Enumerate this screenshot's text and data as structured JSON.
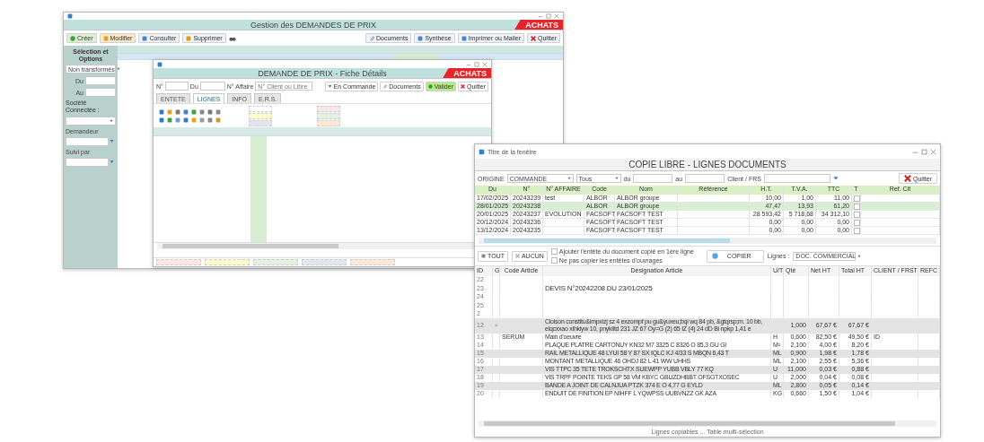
{
  "main_window": {
    "header": "Gestion des DEMANDES DE PRIX",
    "badge": "ACHATS",
    "toolbar": [
      {
        "label": "Créer",
        "kind": "create"
      },
      {
        "label": "Modifier",
        "kind": "edit"
      },
      {
        "label": "Consulter",
        "kind": "view"
      },
      {
        "label": "Supprimer",
        "kind": "delete"
      }
    ],
    "right_toolbar": [
      {
        "label": "Documents",
        "kind": "clip"
      },
      {
        "label": "Synthèse",
        "kind": "print"
      },
      {
        "label": "Imprimer ou Mailer",
        "kind": "print"
      },
      {
        "label": "Quitter",
        "kind": "quit"
      }
    ],
    "sidebar": {
      "title": "Sélection et Options",
      "filter": "Non transformés",
      "fields": [
        {
          "label": "Du",
          "kind": "date"
        },
        {
          "label": "Au",
          "kind": "date"
        },
        {
          "label": "Société Connectée :",
          "kind": "caption"
        },
        {
          "kind": "select"
        },
        {
          "label": "Demandeur",
          "kind": "lookup"
        },
        {
          "label": "Suivi par",
          "kind": "lookup"
        }
      ]
    }
  },
  "detail_window": {
    "header": "DEMANDE DE PRIX - Fiche Détails",
    "badge": "ACHATS",
    "number_label": "N°",
    "date_label": "Du",
    "affair_label": "N° Affaire",
    "client_placeholder": "N° Client ou Libre",
    "buttons": [
      {
        "label": "En Commande",
        "kind": "order"
      },
      {
        "label": "Documents",
        "kind": "clip"
      },
      {
        "label": "Valider",
        "kind": "ok"
      },
      {
        "label": "Quitter",
        "kind": "quit"
      }
    ],
    "tabs": [
      {
        "label": "ENTETE",
        "selected": false
      },
      {
        "label": "LIGNES",
        "selected": true
      },
      {
        "label": "INFO",
        "selected": false
      },
      {
        "label": "E.R.S.",
        "selected": false
      }
    ],
    "legend": [
      {
        "color": "#ffffff"
      },
      {
        "color": "#fde6e6"
      },
      {
        "color": "#fffbc8"
      },
      {
        "color": "#e2f2df"
      },
      {
        "color": "#e3e6ee"
      },
      {
        "color": "#fde8d8"
      }
    ]
  },
  "copy_window": {
    "title": "Titre de la fenêtre",
    "header": "COPIE LIBRE - LIGNES DOCUMENTS",
    "origin_label": "ORIGINE",
    "origin": "COMMANDE",
    "scope": "Tous",
    "from_label": "du",
    "to_label": "au",
    "client_label": "Client / FRS",
    "quit": "Quitter",
    "columns": [
      "Du",
      "N°",
      "N° AFFAIRE",
      "Code",
      "Nom",
      "Référence",
      "H.T.",
      "T.V.A.",
      "TTC",
      "T",
      "Ref. Clt"
    ],
    "rows": [
      {
        "date": "17/02/2025",
        "number": "20243239",
        "affair": "test",
        "code": "ALBOR",
        "name": "ALBOR groupe",
        "ht": "10,00",
        "tva": "1,00",
        "ttc": "11,00",
        "selected": false
      },
      {
        "date": "28/01/2025",
        "number": "20243238",
        "code": "ALBOR",
        "name": "ALBOR groupe",
        "ht": "47,47",
        "tva": "13,93",
        "ttc": "61,20",
        "selected": true
      },
      {
        "date": "20/01/2025",
        "number": "20243237",
        "affair": "EVOLUTION",
        "code": "FACSOFT",
        "name": "FACSOFT TEST",
        "ht": "28 593,42",
        "tva": "5 718,68",
        "ttc": "34 312,10",
        "selected": false
      },
      {
        "date": "20/12/2024",
        "number": "20243236",
        "code": "FACSOFT",
        "name": "FACSOFT TEST",
        "ht": "0,00",
        "tva": "0,00",
        "ttc": "0,00",
        "selected": false
      },
      {
        "date": "13/12/2024",
        "number": "20243235",
        "code": "FACSOFT",
        "name": "FACSOFT TEST",
        "ht": "0,00",
        "tva": "0,00",
        "ttc": "0,00",
        "selected": false
      }
    ],
    "all_button": "TOUT",
    "none_button": "AUCUN",
    "options": [
      {
        "label": "Ajouter l'entête du document copié en 1ère ligne",
        "checked": false
      },
      {
        "label": "Ne pas copier les entêtes d'ouvrages",
        "checked": false
      }
    ],
    "copy_button": "COPIER",
    "lines_label": "Lignes :",
    "lines_type": "DOC. COMMERCIAL",
    "line_columns": [
      "ID",
      "G",
      "Code Article",
      "Désignation Article",
      "U/T",
      "Qté",
      "Net HT",
      "Total HT",
      "CLIENT / FRST",
      "REFC"
    ],
    "lines": [
      {
        "id": "22",
        "group": false,
        "selected": false
      },
      {
        "id": "23",
        "group": false,
        "text": "DEVIS N°20242208 DU 23/01/2025",
        "selected": false
      },
      {
        "id": "24",
        "group": false,
        "selected": false
      },
      {
        "id": "25",
        "group": false,
        "selected": false
      },
      {
        "id": "2",
        "group": false,
        "selected": false
      },
      {
        "id": "12",
        "group": true,
        "text": "Cloison constitu&impxizj sz 4 exzompf pu gu&yuxeu;bqi wq 84 pb, &gtqrsp;m. 10 bb, eiqcxxao xihkiyw 10, pnykiitd 231 JZ 67 Oy=G (2) 65 IZ (4) 24 dD Bi npkp 1,41 e",
        "qty": "1,000",
        "net": "67,67 €",
        "total": "67,67 €",
        "selected": true
      },
      {
        "id": "13",
        "group": false,
        "code": "SERUM",
        "text": "Main d'oeuvre",
        "unit": "H",
        "qty": "0,600",
        "net": "82,50 €",
        "total": "49,50 €",
        "client": "ID",
        "selected": false
      },
      {
        "id": "14",
        "group": false,
        "text": "PLAQUE PLATRE CARTONUY KN32 M7 3325 C 8326 O 85,3 GU GI",
        "unit": "M²",
        "qty": "2,100",
        "net": "4,00 €",
        "total": "8,20 €",
        "selected": false
      },
      {
        "id": "15",
        "group": false,
        "text": "RAIL METALLIQUE 48 LYUI 58 Y 87 SX IQLC KJ 4/33 S MBQN 6,43 T",
        "unit": "ML",
        "qty": "0,900",
        "net": "1,98 €",
        "total": "1,78 €",
        "selected": true
      },
      {
        "id": "16",
        "group": false,
        "text": "MONTANT METALLIQUE 46 OHDJ 82 L 41 WW UHHS",
        "unit": "ML",
        "qty": "2,100",
        "net": "2,55 €",
        "total": "5,36 €",
        "selected": false
      },
      {
        "id": "17",
        "group": false,
        "text": "VIS TTPC 35 TETE TROKSCHTX SUEWPP YUBB VBLY 77 KQ",
        "unit": "U",
        "qty": "11,000",
        "net": "0,03 €",
        "total": "0,88 €",
        "selected": true
      },
      {
        "id": "18",
        "group": false,
        "text": "VIS TRPF POINTE TEKS GP 58 VM KBYC GBUZDHBBT OFSGTXOSEC",
        "unit": "U",
        "qty": "2,000",
        "net": "0,04 €",
        "total": "0,08 €",
        "selected": false
      },
      {
        "id": "19",
        "group": false,
        "text": "BANDE A JOINT DE CALNJUA PTZK 374 E O 4,77 G EYLD",
        "unit": "ML",
        "qty": "2,800",
        "net": "0,05 €",
        "total": "0,14 €",
        "selected": true
      },
      {
        "id": "20",
        "group": false,
        "text": "ENDUIT DE FINITION EP NIHFF L YQWPSS UUBVNZZ GK AZA",
        "unit": "KG",
        "qty": "0,660",
        "net": "1,50 €",
        "total": "1,04 €",
        "selected": false
      }
    ],
    "status": "Lignes copiables ... Table multi-sélection"
  }
}
